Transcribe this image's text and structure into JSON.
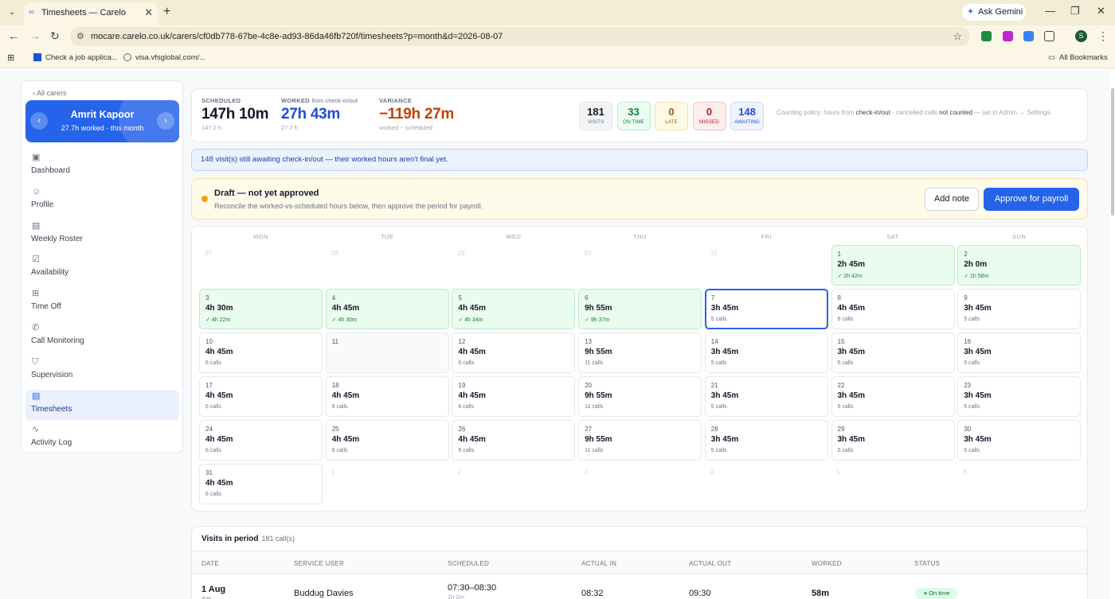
{
  "browser": {
    "tab_title": "Timesheets — Carelo",
    "url": "mocare.carelo.co.uk/carers/cf0db778-67be-4c8e-ad93-86da46fb720f/timesheets?p=month&d=2026-08-07",
    "gemini": "Ask Gemini",
    "bookmarks": [
      "Check a job applica...",
      "visa.vfsglobal.com/..."
    ],
    "all_bookmarks": "All Bookmarks",
    "profile_initial": "S"
  },
  "sidebar": {
    "back": "‹ All carers",
    "carer_name": "Amrit Kapoor",
    "carer_sub": "27.7h worked · this month",
    "items": [
      {
        "label": "Dashboard",
        "icon": "calendar-icon"
      },
      {
        "label": "Profile",
        "icon": "user-icon"
      },
      {
        "label": "Weekly Roster",
        "icon": "roster-icon"
      },
      {
        "label": "Availability",
        "icon": "calendar-check-icon"
      },
      {
        "label": "Time Off",
        "icon": "calendar-plus-icon"
      },
      {
        "label": "Call Monitoring",
        "icon": "phone-icon"
      },
      {
        "label": "Supervision",
        "icon": "shield-icon"
      },
      {
        "label": "Timesheets",
        "icon": "document-icon"
      },
      {
        "label": "Activity Log",
        "icon": "activity-icon"
      }
    ]
  },
  "stats": {
    "scheduled": {
      "label": "SCHEDULED",
      "value": "147h 10m",
      "sub": "147.2 h"
    },
    "worked": {
      "label": "WORKED",
      "note": "from check-in/out",
      "value": "27h 43m",
      "sub": "27.7 h"
    },
    "variance": {
      "label": "VARIANCE",
      "value": "−119h 27m",
      "sub": "worked − scheduled"
    },
    "pills": [
      {
        "n": "181",
        "t": "VISITS"
      },
      {
        "n": "33",
        "t": "ON TIME"
      },
      {
        "n": "0",
        "t": "LATE"
      },
      {
        "n": "0",
        "t": "MISSED"
      },
      {
        "n": "148",
        "t": "AWAITING"
      }
    ],
    "policy_a": "Counting policy: hours from ",
    "policy_b": "check-in/out",
    "policy_c": " · cancelled calls ",
    "policy_d": "not counted",
    "policy_e": " — set in Admin → Settings."
  },
  "colors": {
    "accent": "#2563eb",
    "ok": "#eafbef",
    "warn": "#f59e0b",
    "variance": "#c2410c"
  },
  "info": "148 visit(s) still awaiting check-in/out — their worked hours aren't final yet.",
  "draft": {
    "title": "Draft — not yet approved",
    "sub": "Reconcile the worked-vs-scheduled hours below, then approve the period for payroll.",
    "add_note": "Add note",
    "approve": "Approve for payroll"
  },
  "calendar": {
    "days": [
      "MON",
      "TUE",
      "WED",
      "THU",
      "FRI",
      "SAT",
      "SUN"
    ],
    "weeks": [
      [
        {
          "d": "27",
          "s": "off"
        },
        {
          "d": "28",
          "s": "off"
        },
        {
          "d": "29",
          "s": "off"
        },
        {
          "d": "30",
          "s": "off"
        },
        {
          "d": "31",
          "s": "off"
        },
        {
          "d": "1",
          "h": "2h 45m",
          "sub": "✓ 2h 42m",
          "s": "ok"
        },
        {
          "d": "2",
          "h": "2h 0m",
          "sub": "✓ 1h 58m",
          "s": "ok"
        }
      ],
      [
        {
          "d": "3",
          "h": "4h 30m",
          "sub": "✓ 4h 22m",
          "s": "ok"
        },
        {
          "d": "4",
          "h": "4h 45m",
          "sub": "✓ 4h 30m",
          "s": "ok"
        },
        {
          "d": "5",
          "h": "4h 45m",
          "sub": "✓ 4h 34m",
          "s": "ok"
        },
        {
          "d": "6",
          "h": "9h 55m",
          "sub": "✓ 9h 37m",
          "s": "ok"
        },
        {
          "d": "7",
          "h": "3h 45m",
          "sub": "5 calls",
          "s": "today"
        },
        {
          "d": "8",
          "h": "4h 45m",
          "sub": "6 calls",
          "s": "cur"
        },
        {
          "d": "9",
          "h": "3h 45m",
          "sub": "5 calls",
          "s": "cur"
        }
      ],
      [
        {
          "d": "10",
          "h": "4h 45m",
          "sub": "6 calls",
          "s": "cur"
        },
        {
          "d": "11",
          "s": "empty"
        },
        {
          "d": "12",
          "h": "4h 45m",
          "sub": "6 calls",
          "s": "cur"
        },
        {
          "d": "13",
          "h": "9h 55m",
          "sub": "11 calls",
          "s": "cur"
        },
        {
          "d": "14",
          "h": "3h 45m",
          "sub": "5 calls",
          "s": "cur"
        },
        {
          "d": "15",
          "h": "3h 45m",
          "sub": "5 calls",
          "s": "cur"
        },
        {
          "d": "16",
          "h": "3h 45m",
          "sub": "5 calls",
          "s": "cur"
        }
      ],
      [
        {
          "d": "17",
          "h": "4h 45m",
          "sub": "6 calls",
          "s": "cur"
        },
        {
          "d": "18",
          "h": "4h 45m",
          "sub": "6 calls",
          "s": "cur"
        },
        {
          "d": "19",
          "h": "4h 45m",
          "sub": "6 calls",
          "s": "cur"
        },
        {
          "d": "20",
          "h": "9h 55m",
          "sub": "11 calls",
          "s": "cur"
        },
        {
          "d": "21",
          "h": "3h 45m",
          "sub": "5 calls",
          "s": "cur"
        },
        {
          "d": "22",
          "h": "3h 45m",
          "sub": "5 calls",
          "s": "cur"
        },
        {
          "d": "23",
          "h": "3h 45m",
          "sub": "5 calls",
          "s": "cur"
        }
      ],
      [
        {
          "d": "24",
          "h": "4h 45m",
          "sub": "6 calls",
          "s": "cur"
        },
        {
          "d": "25",
          "h": "4h 45m",
          "sub": "6 calls",
          "s": "cur"
        },
        {
          "d": "26",
          "h": "4h 45m",
          "sub": "6 calls",
          "s": "cur"
        },
        {
          "d": "27",
          "h": "9h 55m",
          "sub": "11 calls",
          "s": "cur"
        },
        {
          "d": "28",
          "h": "3h 45m",
          "sub": "5 calls",
          "s": "cur"
        },
        {
          "d": "29",
          "h": "3h 45m",
          "sub": "5 calls",
          "s": "cur"
        },
        {
          "d": "30",
          "h": "3h 45m",
          "sub": "5 calls",
          "s": "cur"
        }
      ],
      [
        {
          "d": "31",
          "h": "4h 45m",
          "sub": "6 calls",
          "s": "cur"
        },
        {
          "d": "1",
          "s": "off"
        },
        {
          "d": "2",
          "s": "off"
        },
        {
          "d": "3",
          "s": "off"
        },
        {
          "d": "4",
          "s": "off"
        },
        {
          "d": "5",
          "s": "off"
        },
        {
          "d": "6",
          "s": "off"
        }
      ]
    ]
  },
  "visits": {
    "title": "Visits in period",
    "count": "181 call(s)",
    "columns": [
      "DATE",
      "SERVICE USER",
      "SCHEDULED",
      "ACTUAL IN",
      "ACTUAL OUT",
      "WORKED",
      "STATUS"
    ],
    "rows": [
      {
        "date": "1 Aug",
        "day": "Sat",
        "user": "Buddug Davies",
        "scheduled": "07:30–08:30",
        "sched_sub": "1h 0m",
        "in": "08:32",
        "out": "09:30",
        "worked": "58m",
        "status": "On time"
      }
    ]
  }
}
